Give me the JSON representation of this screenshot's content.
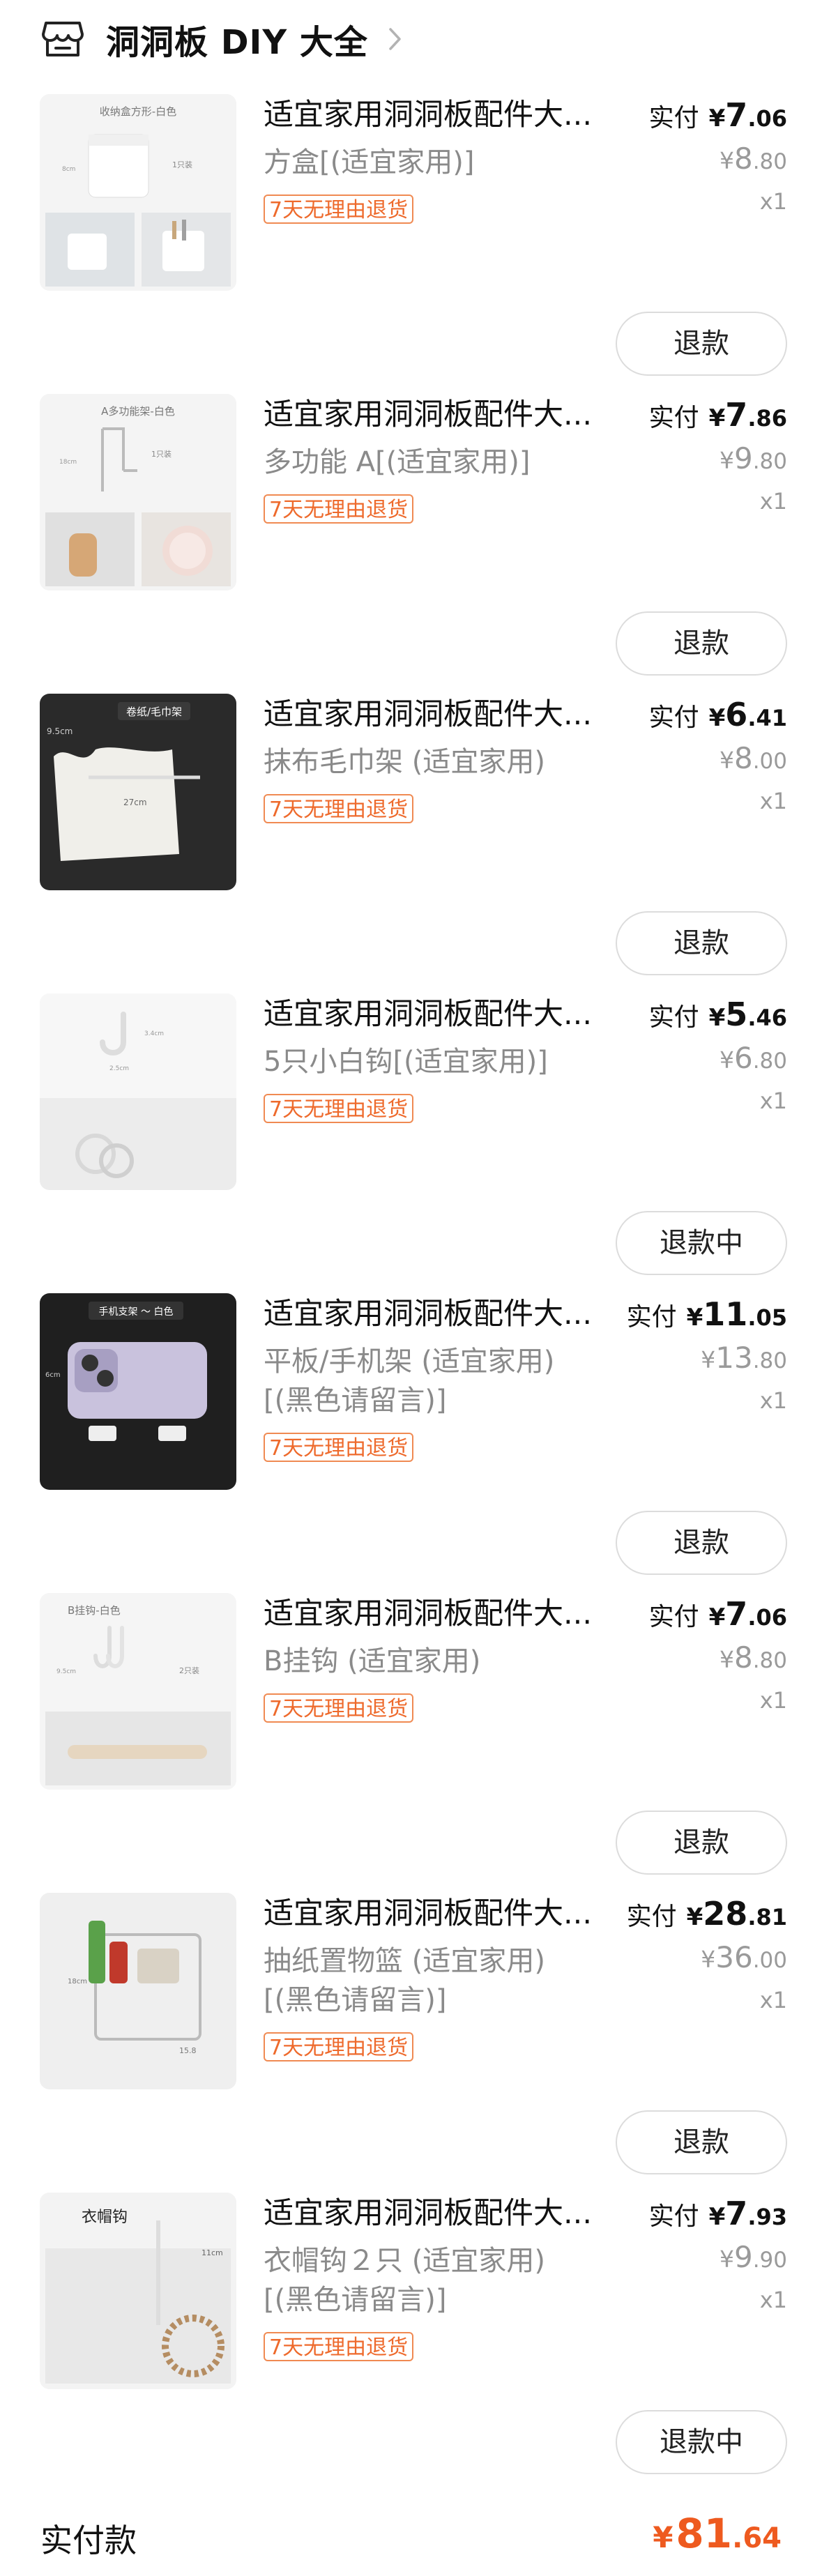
{
  "shop": {
    "name": "洞洞板 DIY 大全",
    "icon": "store-icon"
  },
  "labels": {
    "paid": "实付",
    "total": "实付款",
    "yen": "¥"
  },
  "colors": {
    "accent": "#ee5a1f",
    "tag": "#ee6a2c"
  },
  "items": [
    {
      "title": "适宜家用洞洞板配件大...",
      "spec": "方盒[(适宜家用)]",
      "tag": "7天无理由退货",
      "paid_int": "7",
      "paid_dec": ".06",
      "orig_int": "8",
      "orig_dec": ".80",
      "qty": "x1",
      "button": "退款",
      "thumb": {
        "caption": "收纳盒方形-白色",
        "note1": "1只装",
        "note2": "8cm"
      }
    },
    {
      "title": "适宜家用洞洞板配件大...",
      "spec": "多功能 A[(适宜家用)]",
      "tag": "7天无理由退货",
      "paid_int": "7",
      "paid_dec": ".86",
      "orig_int": "9",
      "orig_dec": ".80",
      "qty": "x1",
      "button": "退款",
      "thumb": {
        "caption": "A多功能架-白色",
        "note1": "1只装",
        "note2": "18cm"
      }
    },
    {
      "title": "适宜家用洞洞板配件大...",
      "spec": "抹布毛巾架 (适宜家用)",
      "tag": "7天无理由退货",
      "paid_int": "6",
      "paid_dec": ".41",
      "orig_int": "8",
      "orig_dec": ".00",
      "qty": "x1",
      "button": "退款",
      "thumb": {
        "caption": "卷纸/毛巾架",
        "note1": "9.5cm",
        "note2": "27cm"
      }
    },
    {
      "title": "适宜家用洞洞板配件大...",
      "spec": "5只小白钩[(适宜家用)]",
      "tag": "7天无理由退货",
      "paid_int": "5",
      "paid_dec": ".46",
      "orig_int": "6",
      "orig_dec": ".80",
      "qty": "x1",
      "button": "退款中",
      "thumb": {
        "caption": "",
        "note1": "3.4cm",
        "note2": "2.5cm"
      }
    },
    {
      "title": "适宜家用洞洞板配件大...",
      "spec": "平板/手机架 (适宜家用)\n[(黑色请留言)]",
      "tag": "7天无理由退货",
      "paid_int": "11",
      "paid_dec": ".05",
      "orig_int": "13",
      "orig_dec": ".80",
      "qty": "x1",
      "button": "退款",
      "thumb": {
        "caption": "手机支架 ～ 白色",
        "note1": "6cm",
        "note2": ""
      }
    },
    {
      "title": "适宜家用洞洞板配件大...",
      "spec": "B挂钩 (适宜家用)",
      "tag": "7天无理由退货",
      "paid_int": "7",
      "paid_dec": ".06",
      "orig_int": "8",
      "orig_dec": ".80",
      "qty": "x1",
      "button": "退款",
      "thumb": {
        "caption": "B挂钩-白色",
        "note1": "2只装",
        "note2": "9.5cm"
      }
    },
    {
      "title": "适宜家用洞洞板配件大...",
      "spec": "抽纸置物篮 (适宜家用)\n[(黑色请留言)]",
      "tag": "7天无理由退货",
      "paid_int": "28",
      "paid_dec": ".81",
      "orig_int": "36",
      "orig_dec": ".00",
      "qty": "x1",
      "button": "退款",
      "thumb": {
        "caption": "",
        "note1": "18cm",
        "note2": "15.8"
      }
    },
    {
      "title": "适宜家用洞洞板配件大...",
      "spec": "衣帽钩２只 (适宜家用)\n[(黑色请留言)]",
      "tag": "7天无理由退货",
      "paid_int": "7",
      "paid_dec": ".93",
      "orig_int": "9",
      "orig_dec": ".90",
      "qty": "x1",
      "button": "退款中",
      "thumb": {
        "caption": "衣帽钩",
        "note1": "11cm",
        "note2": ""
      }
    }
  ],
  "total": {
    "int": "81",
    "dec": ".64"
  }
}
